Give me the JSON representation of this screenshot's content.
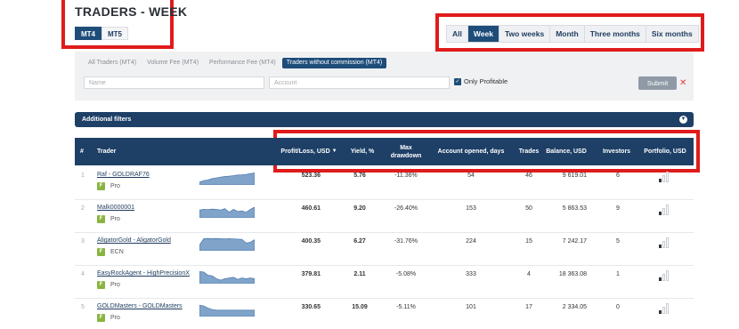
{
  "title": "TRADERS - WEEK",
  "platform_tabs": [
    {
      "label": "MT4",
      "active": true
    },
    {
      "label": "MT5",
      "active": false
    }
  ],
  "period_tabs": [
    {
      "label": "All",
      "active": false
    },
    {
      "label": "Week",
      "active": true
    },
    {
      "label": "Two weeks",
      "active": false
    },
    {
      "label": "Month",
      "active": false
    },
    {
      "label": "Three months",
      "active": false
    },
    {
      "label": "Six months",
      "active": false
    }
  ],
  "filter_tabs": [
    {
      "label": "All Traders (MT4)",
      "active": false
    },
    {
      "label": "Volume Fee (MT4)",
      "active": false
    },
    {
      "label": "Performance Fee (MT4)",
      "active": false
    },
    {
      "label": "Traders without commission (MT4)",
      "active": true
    }
  ],
  "filters": {
    "name_placeholder": "Name",
    "account_placeholder": "Account",
    "only_profitable_label": "Only Profitable",
    "only_profitable_checked": true,
    "submit_label": "Submit",
    "reset_icon": "close-icon"
  },
  "additional_filters_label": "Additional filters",
  "columns": {
    "num": "#",
    "trader": "Trader",
    "profit": "Profit/Loss, USD",
    "yield": "Yield, %",
    "maxdd": "Max drawdown",
    "acc": "Account opened, days",
    "trades": "Trades",
    "balance": "Balance, USD",
    "investors": "Investors",
    "portfolio": "Portfolio, USD"
  },
  "rows": [
    {
      "num": "1",
      "name": "Raf - GOLDRAF76",
      "badge": "F",
      "type": "Pro",
      "profit": "523.36",
      "yield": "5.76",
      "maxdd": "-11.36%",
      "acc": "54",
      "trades": "46",
      "balance": "9 619.01",
      "investors": "6",
      "spark": [
        0.2,
        0.3,
        0.35,
        0.45,
        0.5,
        0.55,
        0.6,
        0.62,
        0.65,
        0.7,
        0.72,
        0.75,
        0.8,
        0.85
      ]
    },
    {
      "num": "2",
      "name": "Malk0000001",
      "badge": "F",
      "type": "Pro",
      "profit": "460.61",
      "yield": "9.20",
      "maxdd": "-26.40%",
      "acc": "153",
      "trades": "50",
      "balance": "5 863.53",
      "investors": "9",
      "spark": [
        0.55,
        0.6,
        0.58,
        0.62,
        0.6,
        0.55,
        0.65,
        0.4,
        0.6,
        0.45,
        0.5,
        0.4,
        0.6,
        0.75
      ]
    },
    {
      "num": "3",
      "name": "AligatorGold - AligatorGold",
      "badge": "F",
      "type": "ECN",
      "profit": "400.35",
      "yield": "6.27",
      "maxdd": "-31.76%",
      "acc": "224",
      "trades": "15",
      "balance": "7 242.17",
      "investors": "5",
      "spark": [
        0.4,
        0.85,
        0.87,
        0.85,
        0.86,
        0.85,
        0.84,
        0.85,
        0.83,
        0.82,
        0.8,
        0.55,
        0.6,
        0.78
      ]
    },
    {
      "num": "4",
      "name": "EasyRockAgent - HighPrecisionX",
      "badge": "F",
      "type": "Pro",
      "profit": "379.81",
      "yield": "2.11",
      "maxdd": "-5.08%",
      "acc": "333",
      "trades": "4",
      "balance": "18 363.08",
      "investors": "1",
      "spark": [
        0.85,
        0.82,
        0.6,
        0.55,
        0.35,
        0.25,
        0.35,
        0.4,
        0.45,
        0.3,
        0.4,
        0.35,
        0.4,
        0.35
      ]
    },
    {
      "num": "5",
      "name": "GOLDMasters - GOLDMasters",
      "badge": "F",
      "type": "Pro",
      "profit": "330.65",
      "yield": "15.09",
      "maxdd": "-5.11%",
      "acc": "101",
      "trades": "17",
      "balance": "2 334.05",
      "investors": "0",
      "spark": [
        0.8,
        0.75,
        0.6,
        0.5,
        0.45,
        0.45,
        0.45,
        0.45,
        0.45,
        0.45,
        0.45,
        0.45,
        0.45,
        0.45
      ]
    }
  ],
  "colors": {
    "primary": "#1e4d7a",
    "header": "#1e3f66",
    "highlight": "#e01b1b",
    "spark_fill": "#7fa3c9",
    "badge": "#8ab441"
  }
}
